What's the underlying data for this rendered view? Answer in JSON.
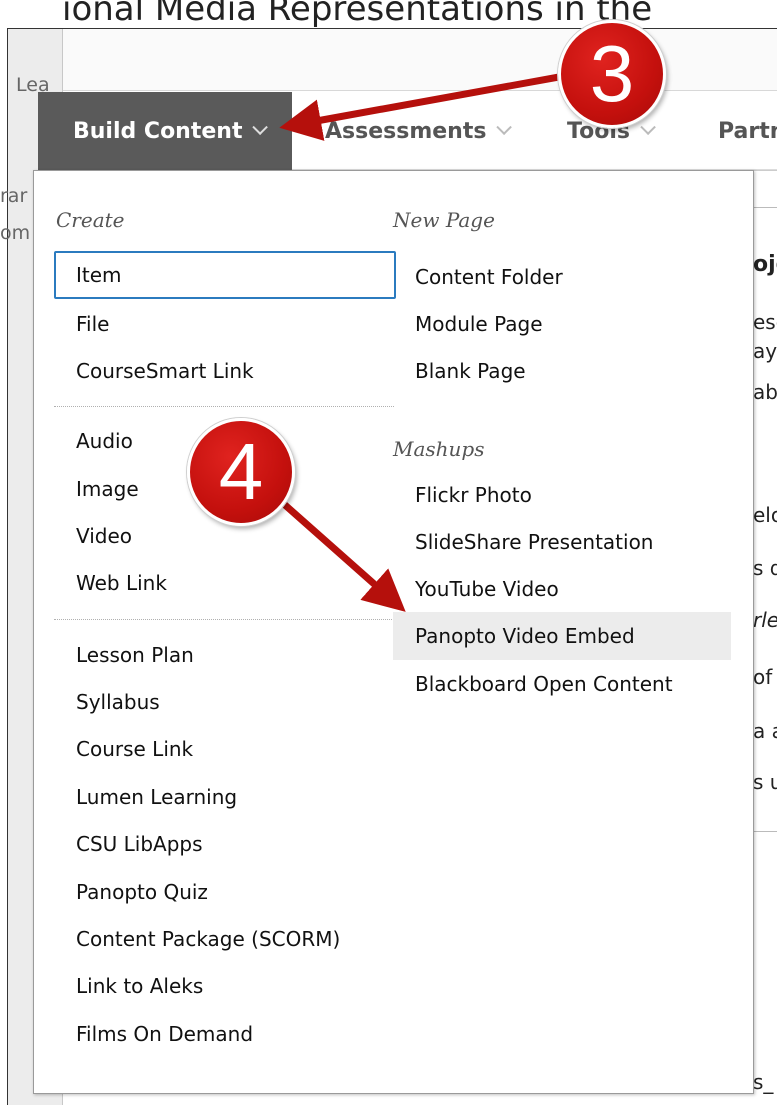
{
  "background": {
    "title_fragment": "ional Media Representations in the",
    "left_fragments": [
      "Lea",
      "rar",
      "om"
    ],
    "right_fragments": [
      "oje",
      "ese",
      "ay",
      "ab",
      "elo",
      "s d",
      "rle",
      "of",
      "a a",
      "s u",
      "s_"
    ]
  },
  "tabs": [
    {
      "label": "Build Content"
    },
    {
      "label": "Assessments"
    },
    {
      "label": "Tools"
    },
    {
      "label": "Partn"
    }
  ],
  "menu": {
    "create": {
      "heading": "Create",
      "items": [
        "Item",
        "File",
        "CourseSmart Link"
      ]
    },
    "media": {
      "items": [
        "Audio",
        "Image",
        "Video",
        "Web Link"
      ]
    },
    "tools": {
      "items": [
        "Lesson Plan",
        "Syllabus",
        "Course Link",
        "Lumen Learning",
        "CSU LibApps",
        "Panopto Quiz",
        "Content Package (SCORM)",
        "Link to Aleks",
        "Films On Demand"
      ]
    },
    "new_page": {
      "heading": "New Page",
      "items": [
        "Content Folder",
        "Module Page",
        "Blank Page"
      ]
    },
    "mashups": {
      "heading": "Mashups",
      "items": [
        "Flickr Photo",
        "SlideShare Presentation",
        "YouTube Video",
        "Panopto Video Embed",
        "Blackboard Open Content"
      ]
    },
    "focused_item": "Item",
    "hovered_item": "Panopto Video Embed"
  },
  "annotations": {
    "step_3": "3",
    "step_4": "4",
    "badge_color": "#d21914"
  }
}
